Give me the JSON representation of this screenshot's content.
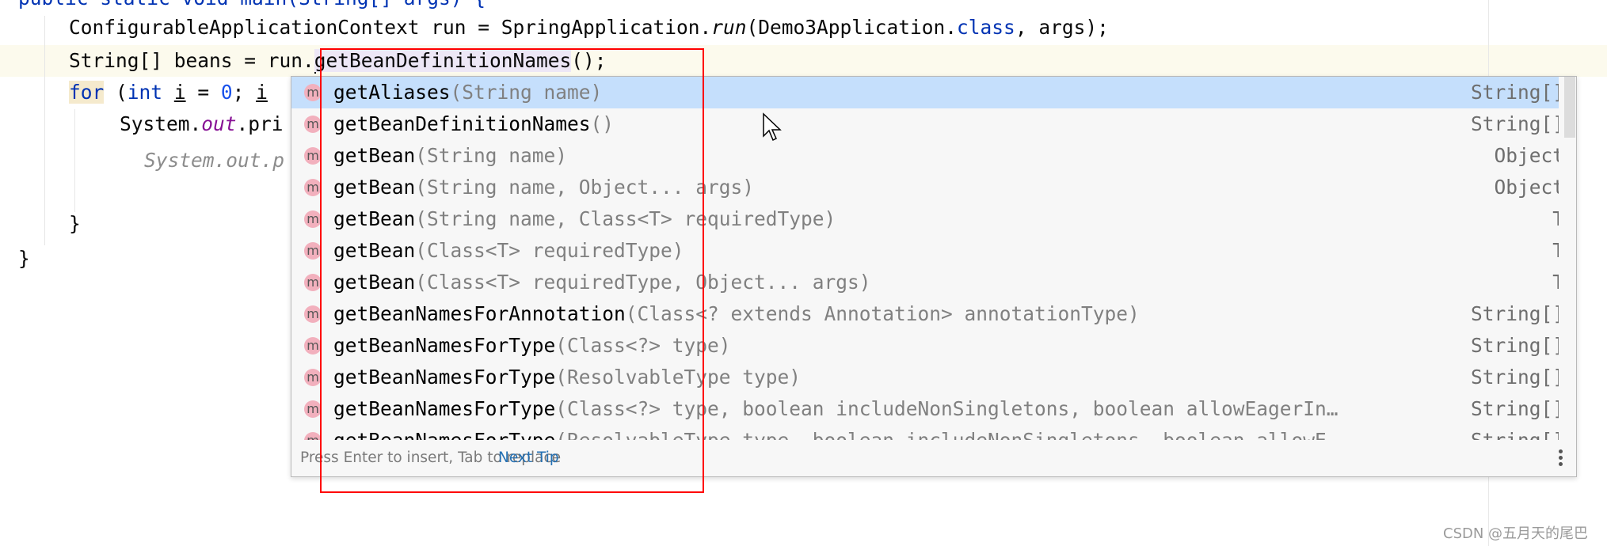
{
  "editor": {
    "line0": "public static void main(String[] args) {",
    "line1": {
      "a": "ConfigurableApplicationContext run = SpringApplication.",
      "b": "run",
      "c": "(Demo3Application.",
      "d": "class",
      "e": ", args);"
    },
    "line2": {
      "a": "String[] beans = run.",
      "b": "getBeanDefinitionNames",
      "c": "();"
    },
    "line3": {
      "a": "for",
      "b": " (",
      "c": "int",
      "d": " ",
      "e": "i",
      "f": " = ",
      "g": "0",
      "h": "; ",
      "i": "i"
    },
    "line4": {
      "a": "System.",
      "b": "out",
      "c": ".pri"
    },
    "line5": "System.out.p",
    "line7": "}",
    "line8": "}"
  },
  "completion": {
    "items": [
      {
        "name": "getAliases",
        "params": "(String name)",
        "type": "String[]",
        "selected": true
      },
      {
        "name": "getBeanDefinitionNames",
        "params": "()",
        "type": "String[]"
      },
      {
        "name": "getBean",
        "params": "(String name)",
        "type": "Object"
      },
      {
        "name": "getBean",
        "params": "(String name, Object... args)",
        "type": "Object"
      },
      {
        "name": "getBean",
        "params": "(String name, Class<T> requiredType)",
        "type": "T"
      },
      {
        "name": "getBean",
        "params": "(Class<T> requiredType)",
        "type": "T"
      },
      {
        "name": "getBean",
        "params": "(Class<T> requiredType, Object... args)",
        "type": "T"
      },
      {
        "name": "getBeanNamesForAnnotation",
        "params": "(Class<? extends Annotation> annotationType)",
        "type": "String[]"
      },
      {
        "name": "getBeanNamesForType",
        "params": "(Class<?> type)",
        "type": "String[]"
      },
      {
        "name": "getBeanNamesForType",
        "params": "(ResolvableType type)",
        "type": "String[]"
      },
      {
        "name": "getBeanNamesForType",
        "params": "(Class<?> type, boolean includeNonSingletons, boolean allowEagerIn…",
        "type": "String[]"
      },
      {
        "name": "getBeanNamesForType",
        "params": "(ResolvableType type, boolean includeNonSingletons, boolean allowE",
        "type": "String[]"
      }
    ],
    "item_icon": "method-icon",
    "item_icon_letter": "m",
    "footer_hint": "Press Enter to insert, Tab to replace",
    "next_tip": "Next Tip"
  },
  "annotation_box_color": "#ff0000",
  "watermark": "CSDN @五月天的尾巴"
}
